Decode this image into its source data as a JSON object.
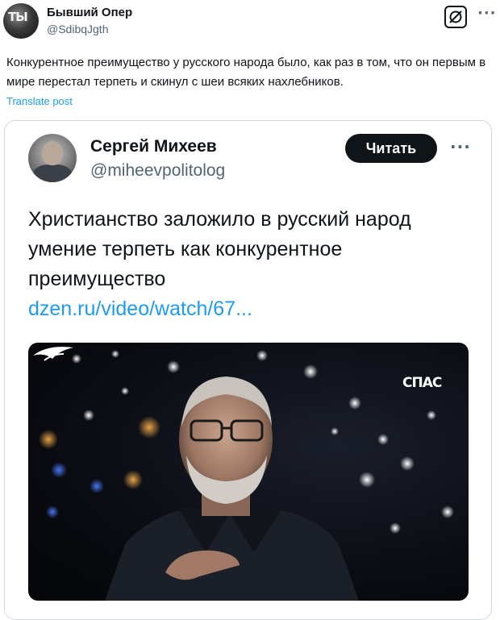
{
  "post": {
    "display_name": "Бывший Опер",
    "handle": "@SdibqJgth",
    "avatar_glyph": "ТЫ",
    "text": "Конкурентное преимущество у русского народа было, как раз в том, что он первым в мире перестал терпеть и скинул с шеи всяких нахлебников.",
    "translate_label": "Translate post",
    "more_icon": "···",
    "grok_icon": "grok-icon"
  },
  "quote": {
    "display_name": "Сергей Михеев",
    "handle": "@miheevpolitolog",
    "follow_label": "Читать",
    "more_icon": "···",
    "text": "Христианство заложило в русский народ умение терпеть как конкурентное преимущество",
    "link": "dzen.ru/video/watch/67...",
    "video": {
      "channel_logo_text": "СПАС"
    }
  },
  "colors": {
    "link": "#1d9bf0",
    "text_primary": "#0f1419",
    "text_secondary": "#536471",
    "border": "#cfd9de",
    "button_bg": "#0f1419"
  }
}
